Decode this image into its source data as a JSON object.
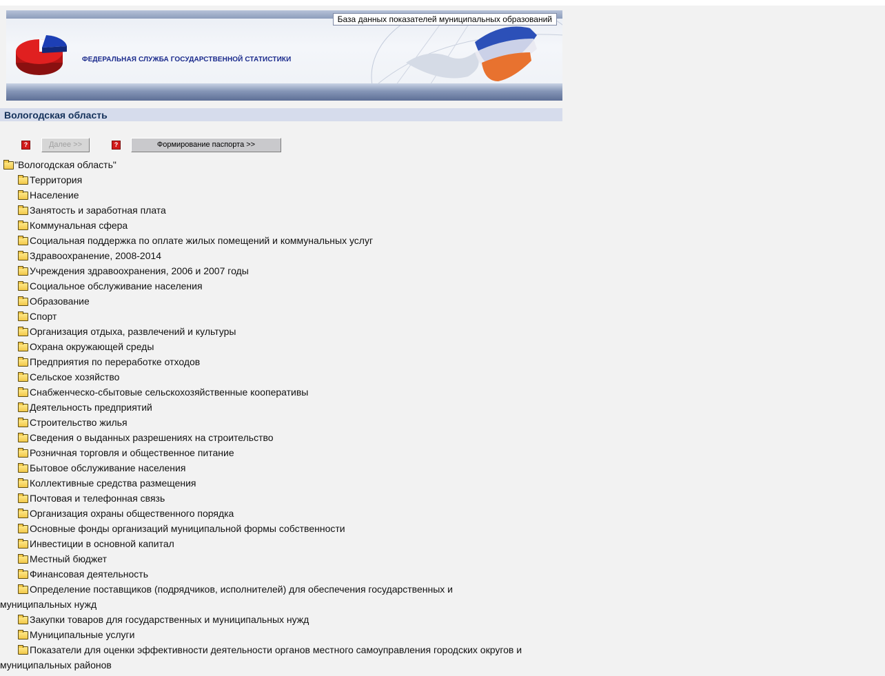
{
  "header": {
    "db_title": "База данных показателей муниципальных образований",
    "agency": "ФЕДЕРАЛЬНАЯ СЛУЖБА ГОСУДАРСТВЕННОЙ СТАТИСТИКИ"
  },
  "region": {
    "title": "Вологодская область"
  },
  "toolbar": {
    "next_label": "Далее >>",
    "passport_label": "Формирование паспорта >>",
    "help_glyph": "?"
  },
  "tree": {
    "root_label": "\"Вологодская область\"",
    "items": [
      "Территория",
      "Население",
      "Занятость и заработная плата",
      "Коммунальная сфера",
      "Социальная поддержка по оплате жилых помещений и коммунальных услуг",
      "Здравоохранение, 2008-2014",
      "Учреждения здравоохранения, 2006 и 2007 годы",
      "Социальное обслуживание населения",
      "Образование",
      "Спорт",
      "Организация отдыха, развлечений и культуры",
      "Охрана окружающей среды",
      "Предприятия по переработке отходов",
      "Сельское хозяйство",
      "Снабженческо-сбытовые сельскохозяйственные кооперативы",
      "Деятельность предприятий",
      "Строительство жилья",
      "Сведения о выданных разрешениях на строительство",
      "Розничная торговля и общественное питание",
      "Бытовое обслуживание населения",
      "Коллективные средства размещения",
      "Почтовая и телефонная связь",
      "Организация охраны общественного порядка",
      "Основные фонды организаций муниципальной формы собственности",
      "Инвестиции в основной капитал",
      "Местный бюджет",
      "Финансовая деятельность",
      "Определение поставщиков (подрядчиков, исполнителей) для обеспечения государственных и муниципальных нужд",
      "Закупки товаров для государственных и муниципальных нужд",
      "Муниципальные услуги",
      "Показатели для оценки эффективности деятельности органов местного самоуправления городских округов и муниципальных районов"
    ]
  },
  "colors": {
    "agency_text": "#1a2a8c",
    "region_bar": "#d6dcec",
    "region_text": "#14315a",
    "help_icon": "#d21b1b"
  }
}
